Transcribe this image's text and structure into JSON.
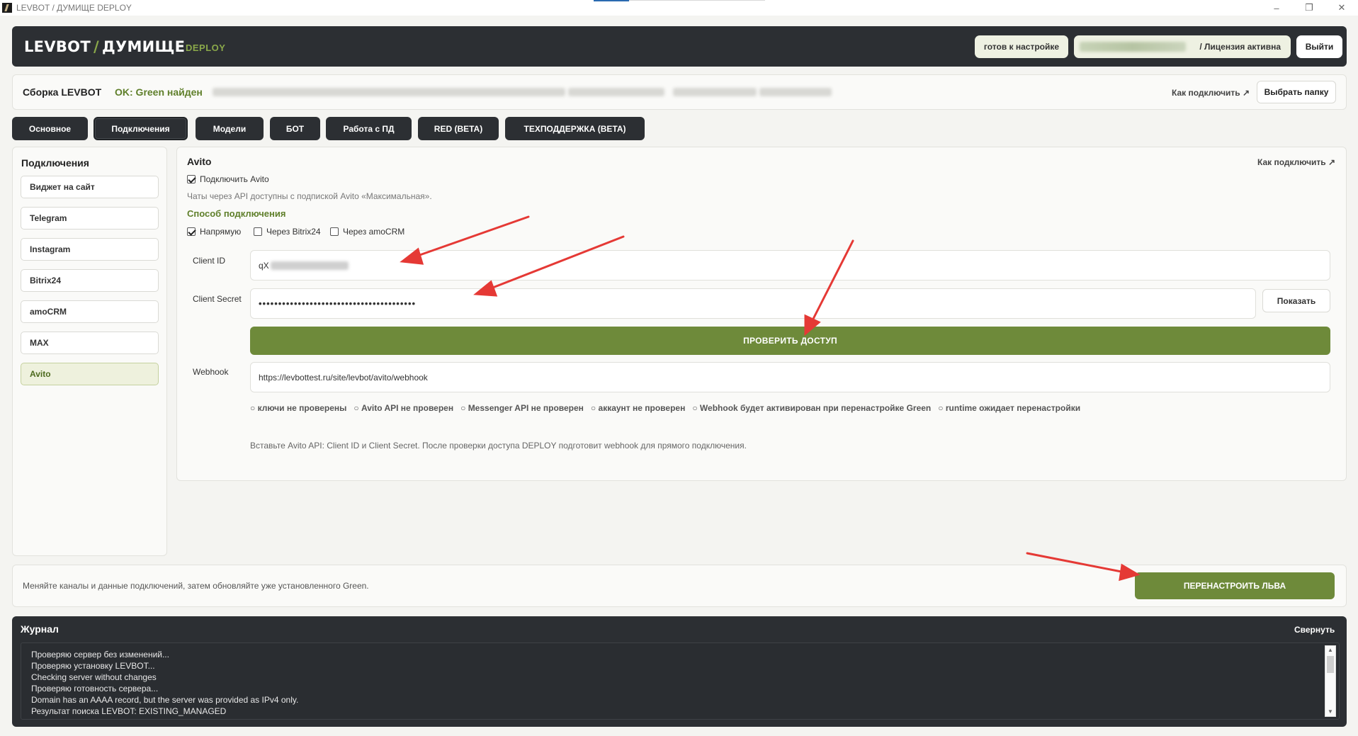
{
  "window": {
    "title": "LEVBOT / ДУМИЩЕ DEPLOY",
    "minimize": "–",
    "restore": "❐",
    "close": "✕"
  },
  "header": {
    "brand_left": "LEVBOT",
    "brand_slash": "/",
    "brand_right": "ДУМИЩЕ",
    "brand_sub": "DEPLOY",
    "status_pill": "готов к настройке",
    "license_text": "/ Лицензия активна",
    "exit_button": "Выйти"
  },
  "buildbar": {
    "label": "Сборка LEVBOT",
    "status": "OK: Green найден",
    "howto_link": "Как подключить ↗",
    "choose_folder": "Выбрать папку"
  },
  "tabs": [
    {
      "label": "Основное"
    },
    {
      "label": "Подключения"
    },
    {
      "label": "Модели"
    },
    {
      "label": "БОТ"
    },
    {
      "label": "Работа с ПД"
    },
    {
      "label": "RED (BETA)"
    },
    {
      "label": "ТЕХПОДДЕРЖКА (BETA)"
    }
  ],
  "active_tab": "Подключения",
  "sidebar": {
    "title": "Подключения",
    "items": [
      {
        "label": "Виджет на сайт"
      },
      {
        "label": "Telegram"
      },
      {
        "label": "Instagram"
      },
      {
        "label": "Bitrix24"
      },
      {
        "label": "amoCRM"
      },
      {
        "label": "MAX"
      },
      {
        "label": "Avito"
      }
    ],
    "active": "Avito"
  },
  "panel": {
    "title": "Avito",
    "howto_link": "Как подключить ↗",
    "enable_checkbox": {
      "label": "Подключить Avito",
      "checked": true
    },
    "note": "Чаты через API доступны с подпиской Avito «Максимальная».",
    "method_label": "Способ подключения",
    "methods": [
      {
        "label": "Напрямую",
        "checked": true
      },
      {
        "label": "Через Bitrix24",
        "checked": false
      },
      {
        "label": "Через amoCRM",
        "checked": false
      }
    ],
    "client_id_label": "Client ID",
    "client_id_value": "qX",
    "client_secret_label": "Client Secret",
    "client_secret_value": "••••••••••••••••••••••••••••••••••••••••",
    "show_button": "Показать",
    "check_button": "ПРОВЕРИТЬ ДОСТУП",
    "webhook_label": "Webhook",
    "webhook_value": "https://levbottest.ru/site/levbot/avito/webhook",
    "statuses": [
      "ключи не проверены",
      "Avito API не проверен",
      "Messenger API не проверен",
      "аккаунт не проверен",
      "Webhook будет активирован при перенастройке Green",
      "runtime ожидает перенастройки"
    ],
    "hint": "Вставьте Avito API: Client ID и Client Secret. После проверки доступа DEPLOY подготовит webhook для прямого подключения."
  },
  "reconfigure": {
    "text": "Меняйте каналы и данные подключений, затем обновляйте уже установленного Green.",
    "button": "ПЕРЕНАСТРОИТЬ ЛЬВА"
  },
  "log": {
    "title": "Журнал",
    "collapse": "Свернуть",
    "lines": [
      "Проверяю сервер без изменений...",
      "Проверяю установку LEVBOT...",
      "Checking server without changes",
      "Проверяю готовность сервера...",
      "Domain has an AAAA record, but the server was provided as IPv4 only.",
      "Результат поиска LEVBOT: EXISTING_MANAGED"
    ]
  },
  "colors": {
    "dark": "#2c2f33",
    "accent_green": "#6e8a3a",
    "label_green": "#5f7f2a",
    "annotation_red": "#e53935"
  }
}
